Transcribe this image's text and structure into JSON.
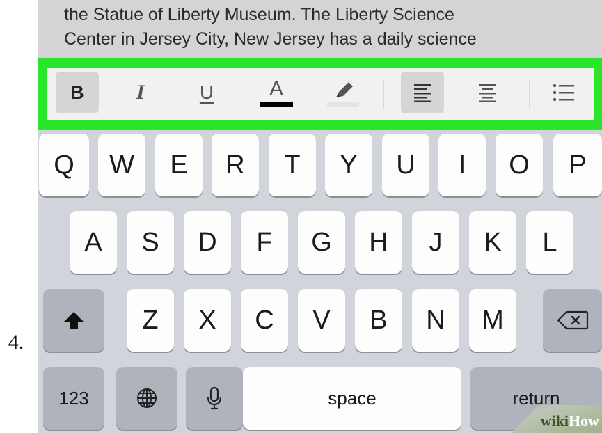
{
  "step": {
    "number": "4."
  },
  "document": {
    "lines": [
      "the Statue of Liberty Museum. The Liberty Science",
      "Center in Jersey City, New Jersey has a daily science"
    ]
  },
  "format_toolbar": {
    "highlight_color": "#2ae52a",
    "bold_label": "B",
    "italic_label": "I",
    "underline_label": "U",
    "text_color_label": "A",
    "text_color_swatch": "#000000",
    "buttons": {
      "bold": "bold-icon",
      "italic": "italic-icon",
      "underline": "underline-icon",
      "text_color": "text-color-icon",
      "highlight": "highlighter-icon",
      "align_left": "align-left-icon",
      "align_center": "align-center-icon",
      "list": "bullet-list-icon"
    }
  },
  "keyboard": {
    "row1": [
      "Q",
      "W",
      "E",
      "R",
      "T",
      "Y",
      "U",
      "I",
      "O",
      "P"
    ],
    "row2": [
      "A",
      "S",
      "D",
      "F",
      "G",
      "H",
      "J",
      "K",
      "L"
    ],
    "row3": [
      "Z",
      "X",
      "C",
      "V",
      "B",
      "N",
      "M"
    ],
    "shift_icon": "shift-icon",
    "delete_icon": "delete-icon",
    "numbers_label": "123",
    "globe_icon": "globe-icon",
    "mic_icon": "microphone-icon",
    "space_label": "space",
    "return_label": "return"
  },
  "watermark": {
    "left": "wiki",
    "right": "How"
  }
}
